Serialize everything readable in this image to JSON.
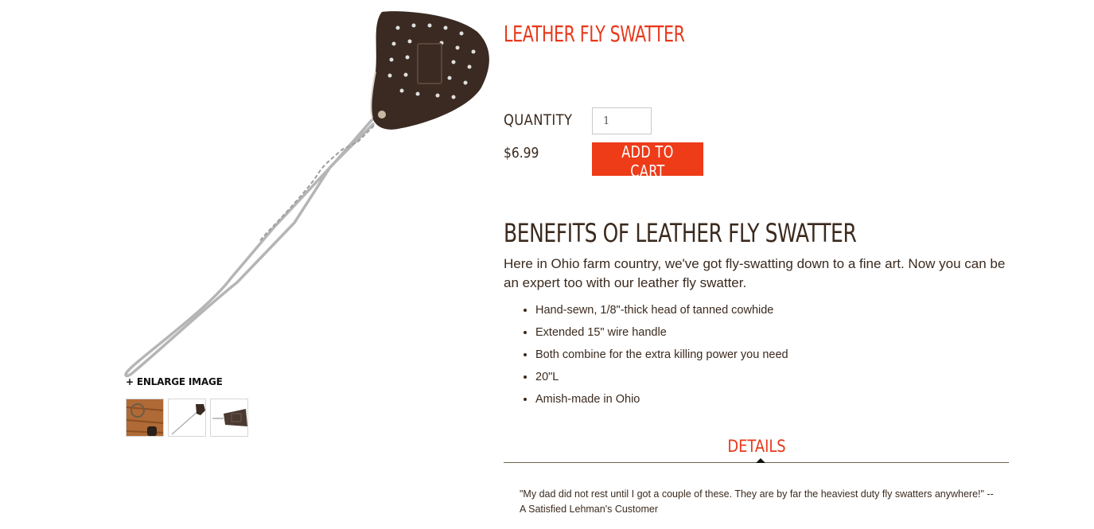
{
  "product": {
    "title": "LEATHER FLY SWATTER",
    "quantity_label": "QUANTITY",
    "quantity_value": "1",
    "price": "$6.99",
    "add_to_cart_label": "ADD TO CART",
    "enlarge_label": "+ ENLARGE IMAGE",
    "image_icon": "fly-swatter-image",
    "thumbnails": [
      {
        "icon": "swatter-on-wood-thumbnail"
      },
      {
        "icon": "full-swatter-thumbnail"
      },
      {
        "icon": "swatter-head-thumbnail"
      }
    ]
  },
  "benefits": {
    "heading": "BENEFITS OF LEATHER FLY SWATTER",
    "intro": "Here in Ohio farm country, we've got fly-swatting down to a fine art. Now you can be an expert too with our leather fly swatter.",
    "items": [
      "Hand-sewn, 1/8\"-thick head of tanned cowhide",
      "Extended 15\" wire handle",
      "Both combine for the extra killing power you need",
      "20\"L",
      "Amish-made in Ohio"
    ]
  },
  "tabs": {
    "details_label": "DETAILS"
  },
  "review": {
    "text": "\"My dad did not rest until I got a couple of these. They are by far the heaviest duty fly swatters anywhere!\" --A Satisfied Lehman's Customer"
  },
  "colors": {
    "accent": "#e8381b",
    "button": "#ee3b18",
    "text": "#3b2a1e",
    "leather": "#3a2a22",
    "wire": "#b8b8b8"
  }
}
